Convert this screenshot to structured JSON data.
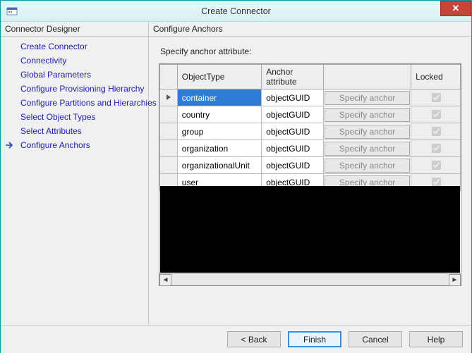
{
  "window": {
    "title": "Create Connector"
  },
  "leftPane": {
    "header": "Connector Designer",
    "items": [
      {
        "label": "Create Connector"
      },
      {
        "label": "Connectivity"
      },
      {
        "label": "Global Parameters"
      },
      {
        "label": "Configure Provisioning Hierarchy"
      },
      {
        "label": "Configure Partitions and Hierarchies"
      },
      {
        "label": "Select Object Types"
      },
      {
        "label": "Select Attributes"
      },
      {
        "label": "Configure Anchors"
      }
    ],
    "selectedIndex": 7
  },
  "rightPane": {
    "header": "Configure Anchors",
    "instruction": "Specify anchor attribute:",
    "columns": {
      "objectType": "ObjectType",
      "anchorAttr": "Anchor attribute",
      "locked": "Locked"
    },
    "specifyButtonLabel": "Specify anchor",
    "rows": [
      {
        "objectType": "container",
        "anchor": "objectGUID",
        "locked": true,
        "selected": true,
        "current": true
      },
      {
        "objectType": "country",
        "anchor": "objectGUID",
        "locked": true
      },
      {
        "objectType": "group",
        "anchor": "objectGUID",
        "locked": true
      },
      {
        "objectType": "organization",
        "anchor": "objectGUID",
        "locked": true
      },
      {
        "objectType": "organizationalUnit",
        "anchor": "objectGUID",
        "locked": true
      },
      {
        "objectType": "user",
        "anchor": "objectGUID",
        "locked": true
      }
    ]
  },
  "footer": {
    "back": "<  Back",
    "finish": "Finish",
    "cancel": "Cancel",
    "help": "Help"
  }
}
